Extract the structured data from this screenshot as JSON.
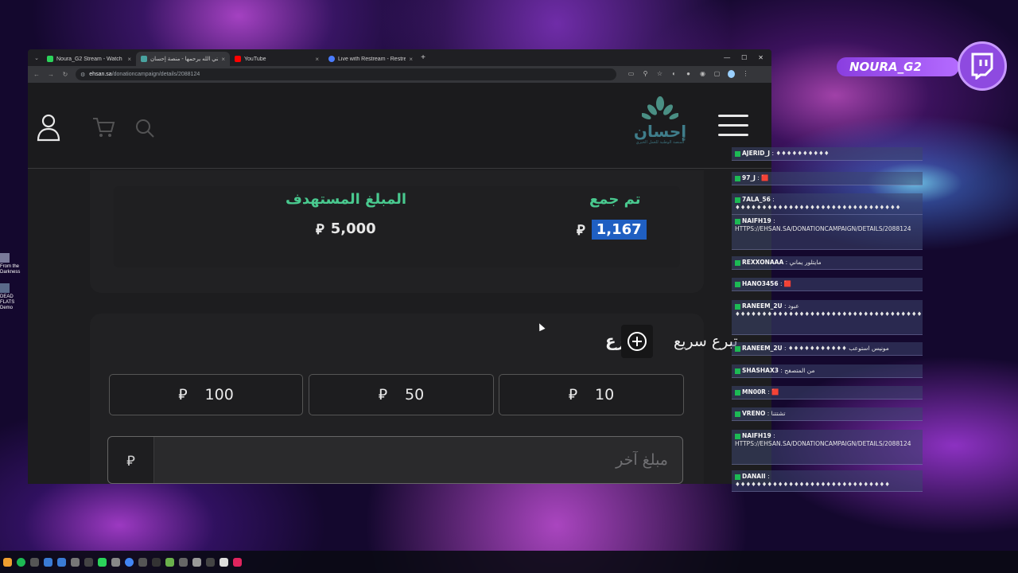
{
  "browser": {
    "tabs": [
      {
        "title": "Noura_G2 Stream - Watch Live",
        "favicon_color": "#2bd35a",
        "active": false
      },
      {
        "title": "جبلني الله يرحمها - منصة إحسان",
        "favicon_color": "#49a3a0",
        "active": true
      },
      {
        "title": "YouTube",
        "favicon_color": "#ff0000",
        "active": false
      },
      {
        "title": "Live with Restream - Restream",
        "favicon_color": "#4a7cff",
        "active": false
      }
    ],
    "url_host": "ehsan.sa",
    "url_path": "/donationcampaign/details/2088124"
  },
  "site": {
    "logo_text": "إحسان",
    "logo_sub": "المنصة الوطنية للعمل الخيري",
    "stats": {
      "collected_label": "تم جمع",
      "collected_value": "1,167",
      "target_label": "المبلغ المستهدف",
      "target_value": "5,000",
      "currency": "⃁"
    },
    "quick_donate": {
      "title_fragment": "رع",
      "label": "تبرع سريع",
      "amounts": [
        "10",
        "50",
        "100"
      ],
      "other_placeholder": "مبلغ آخر"
    }
  },
  "overlay": {
    "channel_name": "NOURA_G2",
    "chat": [
      {
        "user": "AJERID_J",
        "msg": "♦♦♦♦♦♦♦♦♦♦"
      },
      {
        "user": "97_J",
        "msg": "🟥"
      },
      {
        "user": "7ALA_56",
        "msg": "♦♦♦♦♦♦♦♦♦♦♦♦♦♦♦♦♦♦♦♦♦♦♦♦♦♦♦♦♦♦♦"
      },
      {
        "user": "NAIFH19",
        "msg": "HTTPS://EHSAN.SA/DONATIONCAMPAIGN/DETAILS/2088124"
      },
      {
        "user": "REXXONAAA",
        "msg": "مايتلور يماني"
      },
      {
        "user": "HANO3456",
        "msg": "🟥"
      },
      {
        "user": "RANEEM_2U",
        "msg": "عبود ♦♦♦♦♦♦♦♦♦♦♦♦♦♦♦♦♦♦♦♦♦♦♦♦♦♦♦♦♦♦♦♦♦♦♦♦♦♦♦♦"
      },
      {
        "user": "RANEEM_2U",
        "msg": "♦♦♦♦♦♦♦♦♦♦♦ مونيس استوعب"
      },
      {
        "user": "SHASHAX3",
        "msg": "من المتصفح"
      },
      {
        "user": "MN00R",
        "msg": "🟥"
      },
      {
        "user": "VRENO",
        "msg": "تشتتنا"
      },
      {
        "user": "NAIFH19",
        "msg": "HTTPS://EHSAN.SA/DONATIONCAMPAIGN/DETAILS/2088124"
      },
      {
        "user": "DANAII",
        "msg": "♦♦♦♦♦♦♦♦♦♦♦♦♦♦♦♦♦♦♦♦♦♦♦♦♦♦♦♦♦"
      }
    ]
  },
  "desktop": {
    "icons": [
      {
        "label": "From the Darkness"
      },
      {
        "label": "DEAD FLATS Demo"
      }
    ]
  }
}
